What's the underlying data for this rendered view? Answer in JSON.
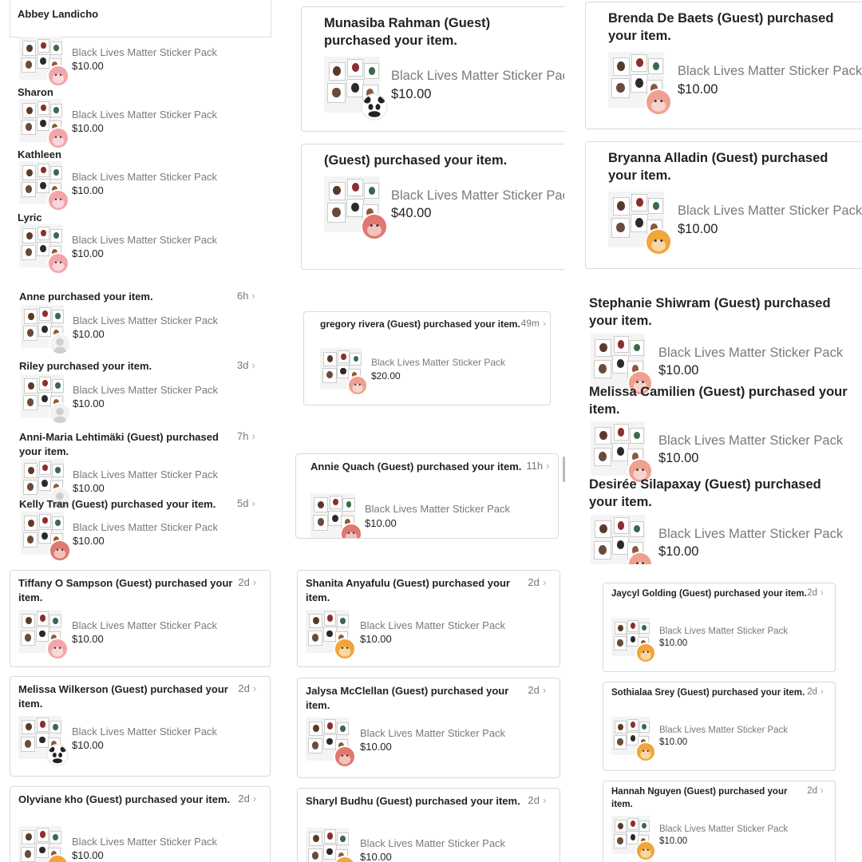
{
  "panels": {
    "p1": {
      "header": "Abbey Landicho",
      "items": [
        {
          "name": "",
          "product": "Black Lives Matter Sticker Pack",
          "price": "$10.00",
          "avatar": "pink"
        },
        {
          "name": "Sharon",
          "product": "Black Lives Matter Sticker Pack",
          "price": "$10.00",
          "avatar": "pink"
        },
        {
          "name": "Kathleen",
          "product": "Black Lives Matter Sticker Pack",
          "price": "$10.00",
          "avatar": "pink"
        },
        {
          "name": "Lyric",
          "product": "Black Lives Matter Sticker Pack",
          "price": "$10.00",
          "avatar": "pink"
        }
      ]
    },
    "p2": {
      "items": [
        {
          "title": "Munasiba Rahman (Guest) purchased your item.",
          "product": "Black Lives Matter Sticker Pack",
          "price": "$10.00",
          "avatar": "panda"
        },
        {
          "title": "(Guest) purchased your item.",
          "product": "Black Lives Matter Sticker Pack",
          "price": "$40.00",
          "avatar": "red"
        }
      ]
    },
    "p3": {
      "items": [
        {
          "title": "Brenda De Baets (Guest) purchased your item.",
          "product": "Black Lives Matter Sticker Pack",
          "price": "$10.00",
          "avatar": "salmon"
        },
        {
          "title": "Bryanna Alladin (Guest) purchased your item.",
          "product": "Black Lives Matter Sticker Pack",
          "price": "$10.00",
          "avatar": "orange"
        }
      ]
    },
    "p4": {
      "items": [
        {
          "title": "Anne purchased your item.",
          "time": "6h",
          "product": "Black Lives Matter Sticker Pack",
          "price": "$10.00",
          "avatar": "gray"
        },
        {
          "title": "Riley purchased your item.",
          "time": "3d",
          "product": "Black Lives Matter Sticker Pack",
          "price": "$10.00",
          "avatar": "gray"
        },
        {
          "title": "Anni-Maria Lehtimäki (Guest) purchased your item.",
          "time": "7h",
          "product": "Black Lives Matter Sticker Pack",
          "price": "$10.00",
          "avatar": "gray"
        },
        {
          "title": "Kelly Tran (Guest) purchased your item.",
          "time": "5d",
          "product": "Black Lives Matter Sticker Pack",
          "price": "$10.00",
          "avatar": "red"
        }
      ]
    },
    "p5": {
      "items": [
        {
          "title": "gregory rivera (Guest) purchased your item.",
          "time": "49m",
          "product": "Black Lives Matter Sticker Pack",
          "price": "$20.00",
          "avatar": "salmon"
        }
      ]
    },
    "p6": {
      "items": [
        {
          "title": "Stephanie Shiwram (Guest) purchased your item.",
          "product": "Black Lives Matter Sticker Pack",
          "price": "$10.00",
          "avatar": "salmon"
        },
        {
          "title": "Melissa Camilien (Guest) purchased your item.",
          "product": "Black Lives Matter Sticker Pack",
          "price": "$10.00",
          "avatar": "salmon"
        },
        {
          "title": "Desirée Silapaxay (Guest) purchased your item.",
          "product": "Black Lives Matter Sticker Pack",
          "price": "$10.00",
          "avatar": "salmon"
        }
      ]
    },
    "p7": {
      "items": [
        {
          "title": "Annie Quach (Guest) purchased your item.",
          "time": "11h",
          "product": "Black Lives Matter Sticker Pack",
          "price": "$10.00",
          "avatar": "red"
        }
      ]
    },
    "p8": {
      "items": [
        {
          "title": "Tiffany O Sampson (Guest) purchased your item.",
          "time": "2d",
          "product": "Black Lives Matter Sticker Pack",
          "price": "$10.00",
          "avatar": "pink"
        },
        {
          "title": "Melissa Wilkerson (Guest) purchased your item.",
          "time": "2d",
          "product": "Black Lives Matter Sticker Pack",
          "price": "$10.00",
          "avatar": "panda"
        },
        {
          "title": "Olyviane kho (Guest) purchased your item.",
          "time": "2d",
          "product": "Black Lives Matter Sticker Pack",
          "price": "$10.00",
          "avatar": "orange"
        }
      ]
    },
    "p9": {
      "items": [
        {
          "title": "Shanita Anyafulu (Guest) purchased your item.",
          "time": "2d",
          "product": "Black Lives Matter Sticker Pack",
          "price": "$10.00",
          "avatar": "orange"
        },
        {
          "title": "Jalysa McClellan (Guest) purchased your item.",
          "time": "2d",
          "product": "Black Lives Matter Sticker Pack",
          "price": "$10.00",
          "avatar": "red"
        },
        {
          "title": "Sharyl Budhu (Guest) purchased your item.",
          "time": "2d",
          "product": "Black Lives Matter Sticker Pack",
          "price": "$10.00",
          "avatar": "orange"
        }
      ]
    },
    "p10": {
      "items": [
        {
          "title": "Jaycyl Golding (Guest) purchased your item.",
          "time": "2d",
          "product": "Black Lives Matter Sticker Pack",
          "price": "$10.00",
          "avatar": "orange"
        },
        {
          "title": "Sothialaa Srey (Guest) purchased your item.",
          "time": "2d",
          "product": "Black Lives Matter Sticker Pack",
          "price": "$10.00",
          "avatar": "orange"
        },
        {
          "title": "Hannah Nguyen (Guest) purchased your item.",
          "time": "2d",
          "product": "Black Lives Matter Sticker Pack",
          "price": "$10.00",
          "avatar": "orange"
        }
      ]
    }
  },
  "icons": {
    "chevron": "›",
    "chevron_name": "chevron-right-icon"
  },
  "colors": {
    "pink": "#f3a6a9",
    "red": "#e0786f",
    "salmon": "#f0a090",
    "orange": "#f2a53a",
    "panda": "#ffffff",
    "gray": "#d8d8d8"
  }
}
